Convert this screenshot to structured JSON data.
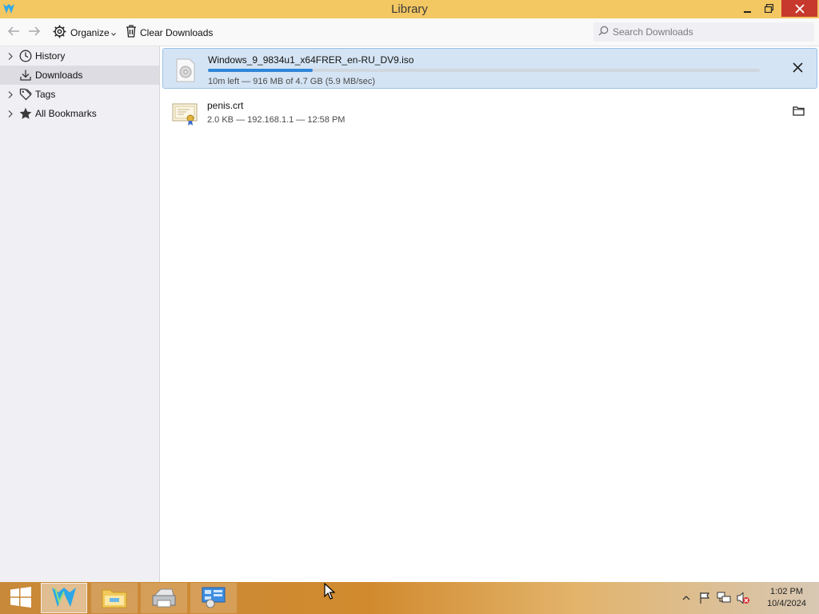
{
  "window": {
    "title": "Library",
    "titlebar_color": "#f3c761",
    "close_color": "#c7392c",
    "app_icon": "waterfox-icon"
  },
  "toolbar": {
    "back_icon": "arrow-left-icon",
    "forward_icon": "arrow-right-icon",
    "organize_label": "Organize",
    "clear_downloads_label": "Clear Downloads",
    "search_placeholder": "Search Downloads"
  },
  "sidebar": {
    "items": [
      {
        "label": "History",
        "icon": "clock-icon",
        "expandable": true,
        "selected": false
      },
      {
        "label": "Downloads",
        "icon": "download-icon",
        "expandable": false,
        "selected": true
      },
      {
        "label": "Tags",
        "icon": "tag-icon",
        "expandable": true,
        "selected": false
      },
      {
        "label": "All Bookmarks",
        "icon": "star-icon",
        "expandable": true,
        "selected": false
      }
    ]
  },
  "downloads": [
    {
      "name": "Windows_9_9834u1_x64FRER_en-RU_DV9.iso",
      "status": "10m left — 916 MB of 4.7 GB (5.9 MB/sec)",
      "progress": 0.19,
      "icon": "disc-image-icon",
      "action_icon": "cancel-icon",
      "in_progress": true
    },
    {
      "name": "penis.crt",
      "status": "2.0 KB — 192.168.1.1 — 12:58 PM",
      "icon": "certificate-icon",
      "action_icon": "folder-icon",
      "in_progress": false
    }
  ],
  "taskbar": {
    "start_icon": "windows-logo-icon",
    "apps": [
      {
        "name": "waterfox-icon",
        "active": true
      },
      {
        "name": "file-explorer-icon",
        "active": false
      },
      {
        "name": "printer-icon",
        "active": false
      },
      {
        "name": "control-panel-icon",
        "active": false
      }
    ],
    "tray": [
      "show-hidden-icons-icon",
      "action-center-flag-icon",
      "network-icon",
      "volume-muted-icon"
    ],
    "time": "1:02 PM",
    "date": "10/4/2024"
  },
  "colors": {
    "accent": "#2f86d8",
    "selection_bg": "#d4e4f4",
    "sidebar_bg": "#f0f0f4"
  }
}
